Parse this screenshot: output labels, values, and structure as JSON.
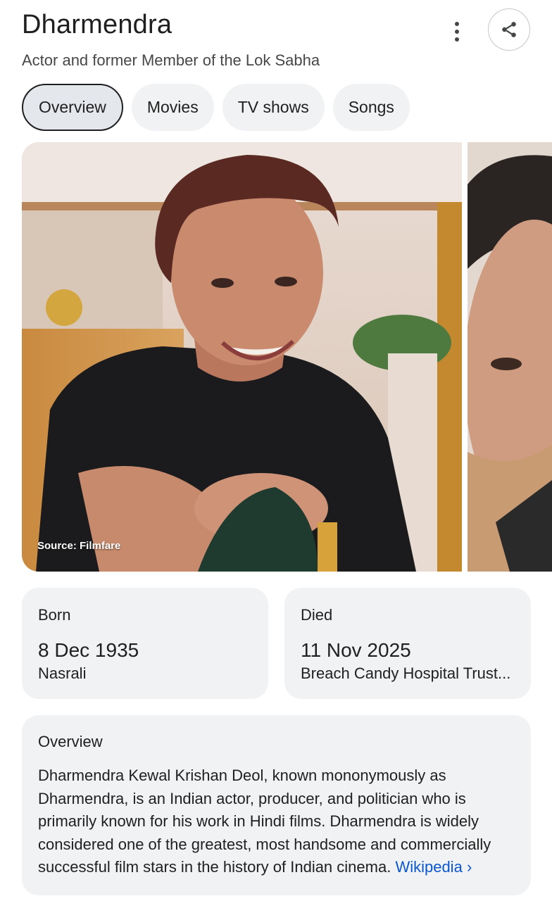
{
  "header": {
    "title": "Dharmendra",
    "subtitle": "Actor and former Member of the Lok Sabha",
    "more_icon": "more-vert-icon",
    "share_icon": "share-icon"
  },
  "tabs": [
    {
      "label": "Overview",
      "active": true
    },
    {
      "label": "Movies",
      "active": false
    },
    {
      "label": "TV shows",
      "active": false
    },
    {
      "label": "Songs",
      "active": false
    }
  ],
  "images": {
    "main_source": "Source: Filmfare"
  },
  "facts": {
    "born": {
      "label": "Born",
      "value": "8 Dec 1935",
      "place": "Nasrali"
    },
    "died": {
      "label": "Died",
      "value": "11 Nov 2025",
      "place": "Breach Candy Hospital Trust..."
    }
  },
  "overview": {
    "heading": "Overview",
    "text": "Dharmendra Kewal Krishan Deol, known mononymously as Dharmendra, is an Indian actor, producer, and politician who is primarily known for his work in Hindi films. Dharmendra is widely considered one of the greatest, most handsome and commercially successful film stars in the history of Indian cinema. ",
    "source_link": "Wikipedia",
    "link_arrow": "›"
  },
  "colors": {
    "card_bg": "#f0f2f4",
    "link": "#0b57d0",
    "text": "#1f1f1f"
  }
}
